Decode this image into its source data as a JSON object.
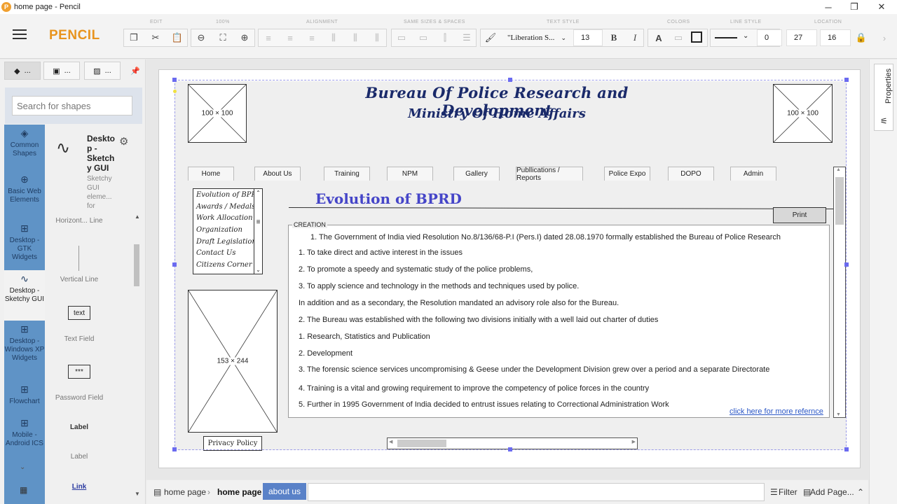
{
  "window": {
    "title": "home page - Pencil",
    "minimize": "─",
    "maximize": "❐",
    "close": "✕"
  },
  "toolbar": {
    "brand": "PENCIL",
    "groups": [
      "EDIT",
      "100%",
      "ALIGNMENT",
      "SAME SIZES & SPACES",
      "TEXT STYLE",
      "COLORS",
      "LINE STYLE",
      "LOCATION"
    ],
    "font_family": "\"Liberation S...",
    "font_size": "13",
    "bold": "B",
    "italic": "I",
    "text_color": "A",
    "line_width": "0",
    "location_x": "27",
    "location_y": "16"
  },
  "sidebar": {
    "search_placeholder": "Search for shapes",
    "collections": [
      {
        "label": "Common Shapes"
      },
      {
        "label": "Basic Web Elements"
      },
      {
        "label": "Desktop - GTK Widgets"
      },
      {
        "label": "Desktop - Sketchy GUI"
      },
      {
        "label": "Desktop - Windows XP Widgets"
      },
      {
        "label": "Flowchart"
      },
      {
        "label": "Mobile - Android ICS"
      }
    ],
    "collection_title": "Desktop - Sketchy GUI",
    "collection_desc": "Sketchy GUI eleme... for",
    "shapes": [
      {
        "label": "Horizont... Line"
      },
      {
        "label": "Vertical Line"
      },
      {
        "label": "Text Field",
        "preview": "text"
      },
      {
        "label": "Password Field",
        "preview": "***"
      },
      {
        "label": "Label",
        "preview": "Label"
      },
      {
        "label": "Link",
        "preview": "Link"
      }
    ]
  },
  "mockup": {
    "header_line1": "Bureau Of Police Research and Development",
    "header_line2": "Ministry Of Home Affairs",
    "logo_left": "100 × 100",
    "logo_right": "100 × 100",
    "side_image": "153 × 244",
    "nav": [
      "Home",
      "About Us",
      "Training",
      "NPM",
      "Gallery",
      "Publlications / Reports",
      "Police Expo",
      "DOPO",
      "Admin"
    ],
    "list": [
      "Evolution of BPRD",
      "Awards / Medals",
      "Work Allocation",
      "Organization",
      "Draft Legislation",
      "Contact Us",
      "Citizens Corner"
    ],
    "page_title": "Evolution of BPRD",
    "print_label": "Print",
    "section_legend": "CREATION",
    "content": [
      "1. The Government of India vied Resolution No.8/136/68-P.I (Pers.I) dated 28.08.1970 formally established the Bureau of Police Research",
      "1.    To take direct and active interest in the issues",
      "2.    To promote a speedy and systematic study of the police problems,",
      "3.    To apply science and technology in the methods and techniques used by police.",
      "In addition and as a secondary, the Resolution mandated an advisory role also for the Bureau.",
      "2. The Bureau was established with the following two divisions initially with a well laid out charter of duties",
      "1.    Research, Statistics and Publication",
      "2.    Development",
      "3. The forensic science services uncompromising & Geese under the Development Division grew over a period and a separate Directorate",
      "4. Training is a vital and growing requirement to improve the competency of police forces in the country",
      "5. Further in 1995 Government of India decided to entrust issues relating to Correctional Administration Work"
    ],
    "more_link": "click here for more refernce",
    "privacy": "Privacy Policy"
  },
  "right_panel": {
    "properties": "Properties"
  },
  "bottom": {
    "crumb1": "home page",
    "crumb2": "home page",
    "active_page": "about us",
    "filter": "Filter",
    "add_page": "Add Page..."
  }
}
